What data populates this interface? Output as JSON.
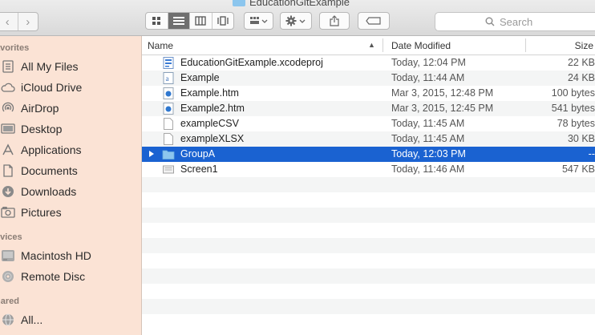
{
  "window": {
    "title": "EducationGitExample"
  },
  "search": {
    "placeholder": "Search"
  },
  "sidebar": {
    "sections": [
      {
        "label": "avorites",
        "items": [
          {
            "label": "All My Files",
            "icon": "all-files-icon"
          },
          {
            "label": "iCloud Drive",
            "icon": "cloud-icon"
          },
          {
            "label": "AirDrop",
            "icon": "airdrop-icon"
          },
          {
            "label": "Desktop",
            "icon": "desktop-icon"
          },
          {
            "label": "Applications",
            "icon": "applications-icon"
          },
          {
            "label": "Documents",
            "icon": "documents-icon"
          },
          {
            "label": "Downloads",
            "icon": "downloads-icon"
          },
          {
            "label": "Pictures",
            "icon": "pictures-icon"
          }
        ]
      },
      {
        "label": "evices",
        "items": [
          {
            "label": "Macintosh HD",
            "icon": "harddisk-icon"
          },
          {
            "label": "Remote Disc",
            "icon": "disc-icon"
          }
        ]
      },
      {
        "label": "hared",
        "items": [
          {
            "label": "All...",
            "icon": "network-icon"
          }
        ]
      }
    ]
  },
  "columns": {
    "name": "Name",
    "date": "Date Modified",
    "size": "Size"
  },
  "files": [
    {
      "name": "EducationGitExample.xcodeproj",
      "date": "Today, 12:04 PM",
      "size": "22 KB",
      "icon": "xcode-project-icon"
    },
    {
      "name": "Example",
      "date": "Today, 11:44 AM",
      "size": "24 KB",
      "icon": "text-document-icon"
    },
    {
      "name": "Example.htm",
      "date": "Mar 3, 2015, 12:48 PM",
      "size": "100 bytes",
      "icon": "html-file-icon"
    },
    {
      "name": "Example2.htm",
      "date": "Mar 3, 2015, 12:45 PM",
      "size": "541 bytes",
      "icon": "html-file-icon"
    },
    {
      "name": "exampleCSV",
      "date": "Today, 11:45 AM",
      "size": "78 bytes",
      "icon": "blank-document-icon"
    },
    {
      "name": "exampleXLSX",
      "date": "Today, 11:45 AM",
      "size": "30 KB",
      "icon": "blank-document-icon"
    },
    {
      "name": "GroupA",
      "date": "Today, 12:03 PM",
      "size": "--",
      "icon": "folder-icon",
      "selected": true
    },
    {
      "name": "Screen1",
      "date": "Today, 11:46 AM",
      "size": "547 KB",
      "icon": "image-file-icon"
    }
  ],
  "colors": {
    "selection": "#1a62d1",
    "sidebar": "#fbe3d5",
    "folder": "#8cc6ee"
  }
}
